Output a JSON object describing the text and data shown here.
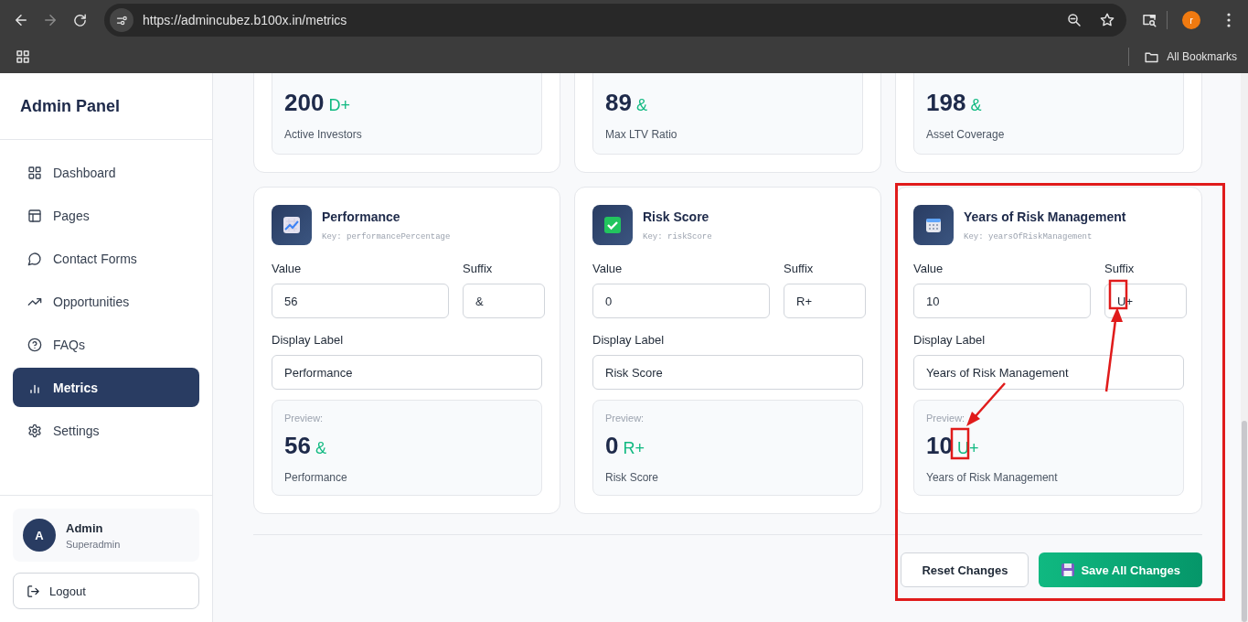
{
  "browser": {
    "url": "https://admincubez.b100x.in/metrics",
    "profile_initial": "r",
    "bookmarks_label": "All Bookmarks"
  },
  "sidebar": {
    "title": "Admin Panel",
    "items": [
      {
        "label": "Dashboard",
        "selected": false
      },
      {
        "label": "Pages",
        "selected": false
      },
      {
        "label": "Contact Forms",
        "selected": false
      },
      {
        "label": "Opportunities",
        "selected": false
      },
      {
        "label": "FAQs",
        "selected": false
      },
      {
        "label": "Metrics",
        "selected": true
      },
      {
        "label": "Settings",
        "selected": false
      }
    ],
    "user": {
      "initial": "A",
      "name": "Admin",
      "role": "Superadmin"
    },
    "logout": "Logout"
  },
  "metrics_partial": [
    {
      "value": "200",
      "suffix": "D+",
      "label": "Active Investors"
    },
    {
      "value": "89",
      "suffix": "&",
      "label": "Max LTV Ratio"
    },
    {
      "value": "198",
      "suffix": "&",
      "label": "Asset Coverage"
    }
  ],
  "metrics": [
    {
      "title": "Performance",
      "key": "Key: performancePercentage",
      "value_label": "Value",
      "value": "56",
      "suffix_label": "Suffix",
      "suffix": "&",
      "display_label_label": "Display Label",
      "display_label": "Performance",
      "preview_label": "Preview:",
      "preview_value": "56",
      "preview_suffix": "&",
      "preview_text": "Performance"
    },
    {
      "title": "Risk Score",
      "key": "Key: riskScore",
      "value_label": "Value",
      "value": "0",
      "suffix_label": "Suffix",
      "suffix": "R+",
      "display_label_label": "Display Label",
      "display_label": "Risk Score",
      "preview_label": "Preview:",
      "preview_value": "0",
      "preview_suffix": "R+",
      "preview_text": "Risk Score"
    },
    {
      "title": "Years of Risk Management",
      "key": "Key: yearsOfRiskManagement",
      "value_label": "Value",
      "value": "10",
      "suffix_label": "Suffix",
      "suffix": "U+",
      "display_label_label": "Display Label",
      "display_label": "Years of Risk Management",
      "preview_label": "Preview:",
      "preview_value": "10",
      "preview_suffix": "U+",
      "preview_text": "Years of Risk Management"
    }
  ],
  "actions": {
    "reset": "Reset Changes",
    "save": "Save All Changes"
  }
}
